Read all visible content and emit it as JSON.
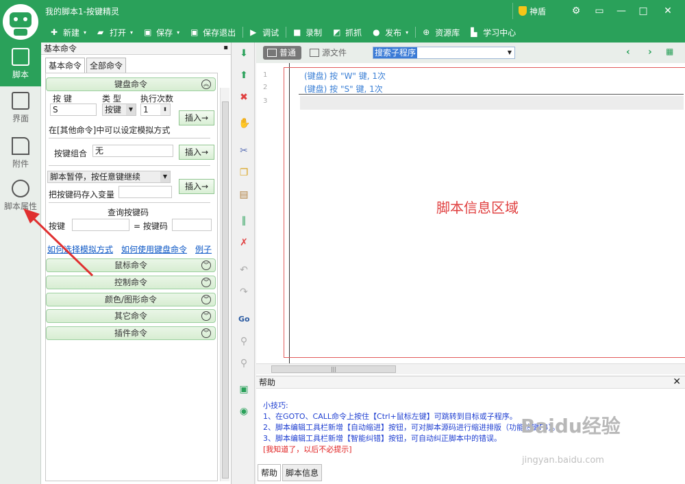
{
  "window": {
    "title": "我的脚本1-按键精灵",
    "shield_label": "神盾",
    "controls": [
      "⚙",
      "▭",
      "—",
      "□",
      "✕"
    ]
  },
  "toolbar": {
    "items": [
      {
        "label": "新建",
        "icon": "plus-icon",
        "caret": true
      },
      {
        "label": "打开",
        "icon": "folder-icon",
        "caret": true
      },
      {
        "label": "保存",
        "icon": "save-icon",
        "caret": true
      },
      {
        "label": "保存退出",
        "icon": "save-exit-icon",
        "caret": false
      },
      {
        "label": "调试",
        "icon": "play-icon",
        "caret": false
      },
      {
        "label": "录制",
        "icon": "camera-icon",
        "caret": false
      },
      {
        "label": "抓抓",
        "icon": "capture-icon",
        "caret": false
      },
      {
        "label": "发布",
        "icon": "publish-icon",
        "caret": true
      },
      {
        "label": "资源库",
        "icon": "resource-icon",
        "caret": false
      },
      {
        "label": "学习中心",
        "icon": "learn-icon",
        "caret": false
      }
    ]
  },
  "leftnav": {
    "items": [
      {
        "label": "脚本",
        "icon": "script-icon",
        "active": true
      },
      {
        "label": "界面",
        "icon": "layout-icon",
        "active": false
      },
      {
        "label": "附件",
        "icon": "attachment-icon",
        "active": false
      },
      {
        "label": "脚本属性",
        "icon": "info-icon",
        "active": false
      }
    ]
  },
  "cmd_panel": {
    "header": "基本命令",
    "pin": "▪",
    "tabs": [
      "基本命令",
      "全部命令"
    ],
    "keyboard_group": "键盘命令",
    "col_key": "按 键",
    "col_type": "类 型",
    "col_count": "执行次数",
    "key_value": "S",
    "type_value": "按键",
    "count_value": "1",
    "insert_label": "插入→",
    "mode_hint": "在[其他命令]中可以设定模拟方式",
    "combo_label": "按键组合",
    "combo_value": "无",
    "pause_value": "脚本暂停，按任意键继续",
    "store_var_label": "把按键码存入变量",
    "query_title": "查询按键码",
    "query_key_label": "按键",
    "query_code_label": "= 按键码",
    "links": [
      "如何选择模拟方式",
      "如何使用键盘命令",
      "例子"
    ],
    "groups": [
      "鼠标命令",
      "控制命令",
      "颜色/图形命令",
      "其它命令",
      "插件命令"
    ]
  },
  "editor": {
    "tab_normal": "普通",
    "tab_source": "源文件",
    "search_placeholder": "搜索子程序",
    "lines": [
      {
        "num": "1",
        "code": "(键盘) 按 \"W\" 键, 1次"
      },
      {
        "num": "2",
        "code": "(键盘) 按 \"S\" 键, 1次"
      },
      {
        "num": "3",
        "code": ""
      }
    ],
    "info_area": "脚本信息区域"
  },
  "help": {
    "title": "帮助",
    "tips_title": "小技巧:",
    "tips": [
      "1、在GOTO、CALL命令上按住【Ctrl+鼠标左键】可跳转到目标或子程序。",
      "2、脚本编辑工具栏新增【自动缩进】按钮，可对脚本源码进行缩进排版（功能热键F4）。",
      "3、脚本编辑工具栏新增【智能纠错】按钮，可自动纠正脚本中的错误。"
    ],
    "dismiss": "[我知道了，以后不必提示]",
    "tabs": [
      "帮助",
      "脚本信息"
    ]
  },
  "watermark": {
    "brand": "Baidu经验",
    "url": "jingyan.baidu.com"
  },
  "colors": {
    "brand_green": "#2aa15a",
    "info_red": "#e04040",
    "tip_blue": "#1f3fd1"
  }
}
